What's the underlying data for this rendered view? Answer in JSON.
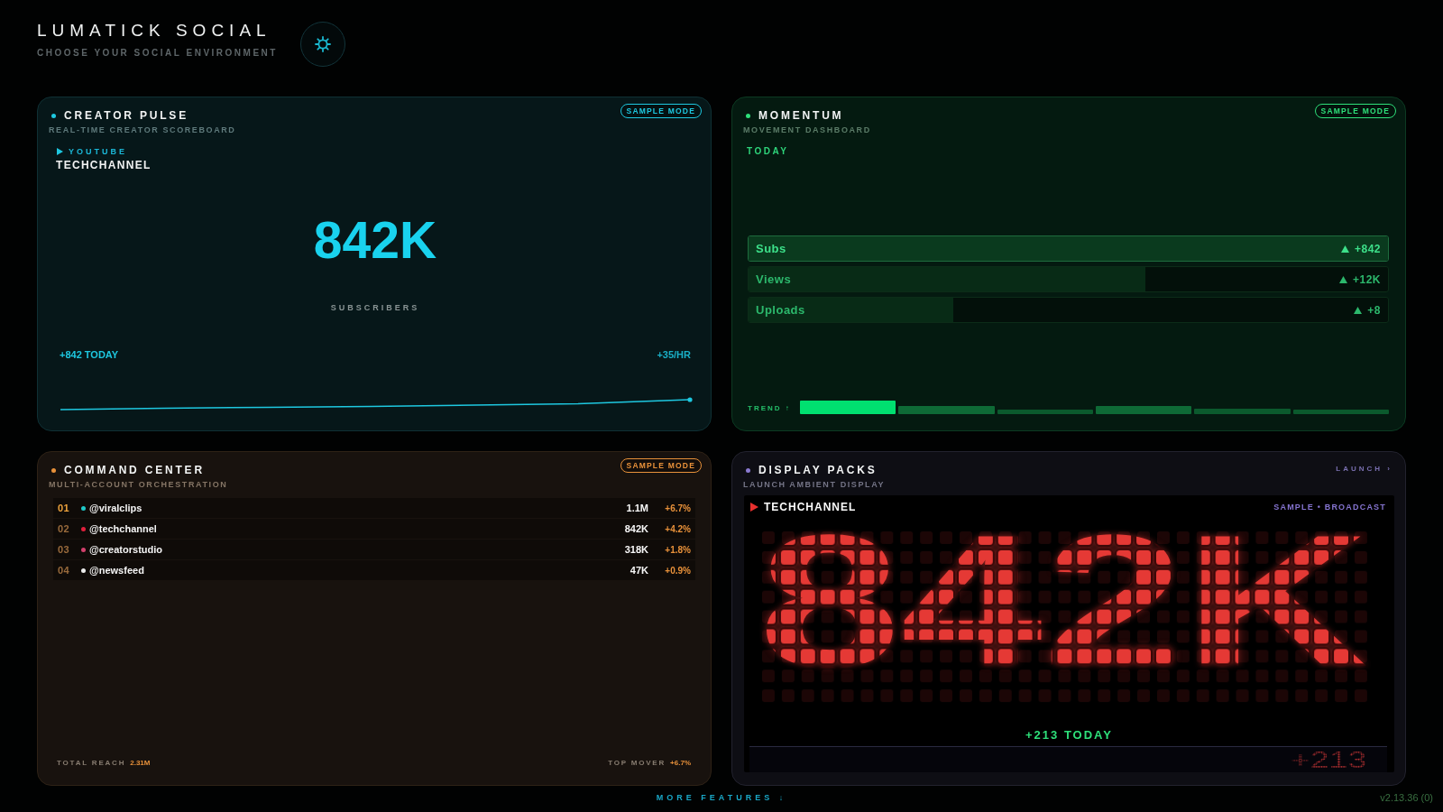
{
  "header": {
    "title": "LUMATICK SOCIAL",
    "subtitle": "CHOOSE YOUR SOCIAL ENVIRONMENT"
  },
  "cards": [
    {
      "kind": "pulse",
      "color": "#1ec8e0",
      "title": "CREATOR PULSE",
      "subtitle": "REAL-TIME CREATOR SCOREBOARD",
      "badge": "SAMPLE MODE",
      "platform": "YOUTUBE",
      "channel": "TECHCHANNEL",
      "count": "842K",
      "count_label": "SUBSCRIBERS",
      "today": "+842 TODAY",
      "rate": "+35/HR"
    },
    {
      "kind": "momentum",
      "color": "#2ee07a",
      "title": "MOMENTUM",
      "subtitle": "MOVEMENT DASHBOARD",
      "badge": "SAMPLE MODE",
      "period": "TODAY",
      "metrics": [
        {
          "name": "Subs",
          "change": "+842",
          "level": 1,
          "selected": true
        },
        {
          "name": "Views",
          "change": "+12K",
          "level": 0.62,
          "selected": false
        },
        {
          "name": "Uploads",
          "change": "+8",
          "level": 0.32,
          "selected": false
        }
      ],
      "trend_label": "TREND ↑"
    },
    {
      "kind": "accounts",
      "color": "#e8913a",
      "title": "COMMAND CENTER",
      "subtitle": "MULTI-ACCOUNT ORCHESTRATION",
      "badge": "SAMPLE MODE",
      "accounts": [
        {
          "rank": "01",
          "handle": "@viralclips",
          "color": "#1fc8c8",
          "count": "1.1M",
          "change": "+6.7%",
          "highlighted": true
        },
        {
          "rank": "02",
          "handle": "@techchannel",
          "color": "#e0203c",
          "count": "842K",
          "change": "+4.2%",
          "highlighted": false
        },
        {
          "rank": "03",
          "handle": "@creatorstudio",
          "color": "#d2406c",
          "count": "318K",
          "change": "+1.8%",
          "highlighted": false
        },
        {
          "rank": "04",
          "handle": "@newsfeed",
          "color": "#ececec",
          "count": "47K",
          "change": "+0.9%",
          "highlighted": false
        }
      ],
      "total_label": "TOTAL REACH",
      "total": "2.31M",
      "mover_label": "TOP MOVER",
      "mover": "+6.7%"
    },
    {
      "kind": "display",
      "color": "#8a7ad0",
      "title": "DISPLAY PACKS",
      "subtitle": "LAUNCH AMBIENT DISPLAY",
      "link": "LAUNCH ›",
      "channel": "TECHCHANNEL",
      "tags": "SAMPLE • BROADCAST",
      "led_value": "842K",
      "today": "+213 TODAY",
      "ticker": "+213"
    }
  ],
  "footer": {
    "more": "MORE FEATURES ↓",
    "version": "v2.13.36 (0)"
  }
}
